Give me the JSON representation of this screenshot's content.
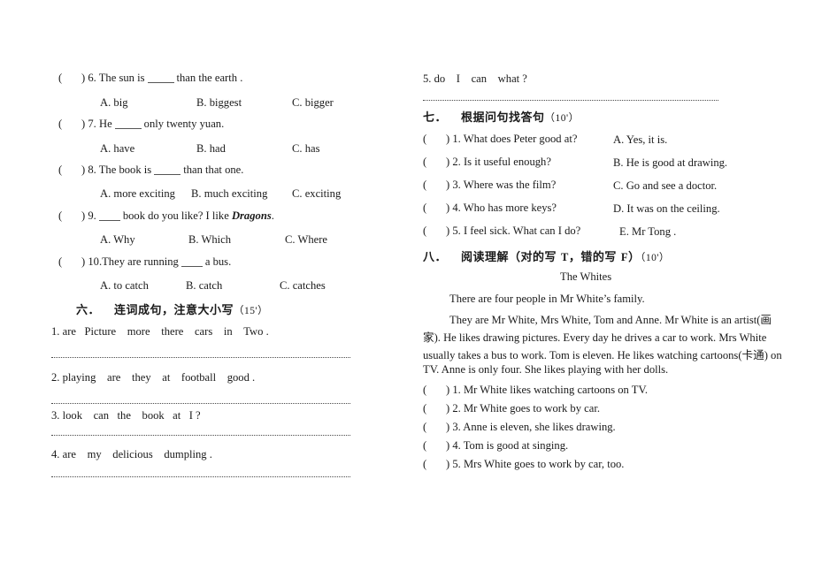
{
  "document": {
    "type": "english-exam-worksheet",
    "columns": 2
  },
  "left_column": {
    "multiple_choice": [
      {
        "bracket_open": "(",
        "bracket_close": ")",
        "number": "6.",
        "stem_before": "The sun is",
        "stem_after": "than the earth .",
        "options": [
          "A. big",
          "B. biggest",
          "C. bigger"
        ]
      },
      {
        "bracket_open": "(",
        "bracket_close": ")",
        "number": "7.",
        "stem_before": "He",
        "stem_after": "only twenty yuan.",
        "options": [
          "A. have",
          "B. had",
          "C. has"
        ]
      },
      {
        "bracket_open": "(",
        "bracket_close": ")",
        "number": "8.",
        "stem_before": "The book is",
        "stem_after": "than that one.",
        "options": [
          "A. more exciting",
          "B. much exciting",
          "C. exciting"
        ]
      },
      {
        "bracket_open": "(",
        "bracket_close": ")",
        "number": "9.",
        "stem_before": "",
        "stem_after": "book do you like? I like ",
        "stem_emphasis": "Dragons",
        "stem_tail": ".",
        "options": [
          "A. Why",
          "B. Which",
          "C. Where"
        ]
      },
      {
        "bracket_open": "(",
        "bracket_close": ")",
        "number": "10.",
        "stem_before": "They are running",
        "stem_after": "a bus.",
        "options": [
          "A. to catch",
          "B. catch",
          "C. catches"
        ]
      }
    ],
    "section_six": {
      "num": "六．",
      "title": "连词成句，注意大小写",
      "score": "（15'）",
      "items": [
        {
          "number": "1.",
          "words": [
            "are",
            "Picture",
            "more",
            "there",
            "cars",
            "in",
            "Two ."
          ]
        },
        {
          "number": "2.",
          "words": [
            "playing",
            "are",
            "they",
            "at",
            "football",
            "good ."
          ]
        },
        {
          "number": "3.",
          "words": [
            "look",
            "can",
            "the",
            "book",
            "at",
            "I ?"
          ]
        },
        {
          "number": "4.",
          "words": [
            "are",
            "my",
            "delicious",
            "dumpling ."
          ]
        }
      ]
    }
  },
  "right_column": {
    "scramble_carryover": {
      "number": "5.",
      "words": [
        "do",
        "I",
        "can",
        "what ?"
      ]
    },
    "section_seven": {
      "num": "七．",
      "title": "根据问句找答句",
      "score": "（10'）",
      "questions": [
        {
          "bracket_open": "(",
          "bracket_close": ")",
          "number": "1.",
          "text": "What does Peter good at?"
        },
        {
          "bracket_open": "(",
          "bracket_close": ")",
          "number": "2.",
          "text": "Is it useful enough?"
        },
        {
          "bracket_open": "(",
          "bracket_close": ")",
          "number": "3.",
          "text": "Where was the film?"
        },
        {
          "bracket_open": "(",
          "bracket_close": ")",
          "number": "4.",
          "text": "Who has more keys?"
        },
        {
          "bracket_open": "(",
          "bracket_close": ")",
          "number": "5.",
          "text": "I feel sick. What can I do?"
        }
      ],
      "answers": [
        "A. Yes, it is.",
        "B. He is good at drawing.",
        "C. Go and see a doctor.",
        "D. It was on the ceiling.",
        "E. Mr Tong ."
      ]
    },
    "section_eight": {
      "num": "八．",
      "title_a": "阅读理解（对的写 ",
      "title_t": "T",
      "title_b": "，错的写 ",
      "title_f": "F",
      "title_c": "）",
      "score": "（10'）",
      "passage_title": "The     Whites",
      "passage_lines": [
        "There are four people in Mr White’s family.",
        "They are Mr White, Mrs White, Tom and Anne. Mr White is an artist(画",
        "家). He likes drawing pictures. Every day he drives a car to work. Mrs White",
        "usually takes a bus to work. Tom is eleven. He likes watching cartoons(卡通) on",
        "TV. Anne is only four. She likes playing with her dolls."
      ],
      "statements": [
        {
          "bracket_open": "(",
          "bracket_close": ")",
          "number": "1.",
          "text": "Mr White likes watching cartoons on TV."
        },
        {
          "bracket_open": "(",
          "bracket_close": ")",
          "number": "2.",
          "text": "Mr White goes to work by car."
        },
        {
          "bracket_open": "(",
          "bracket_close": ")",
          "number": "3.",
          "text": "Anne is eleven, she likes drawing."
        },
        {
          "bracket_open": "(",
          "bracket_close": ")",
          "number": "4.",
          "text": "Tom is good at singing."
        },
        {
          "bracket_open": "(",
          "bracket_close": ")",
          "number": "5.",
          "text": "Mrs White goes to work by car, too."
        }
      ]
    }
  }
}
